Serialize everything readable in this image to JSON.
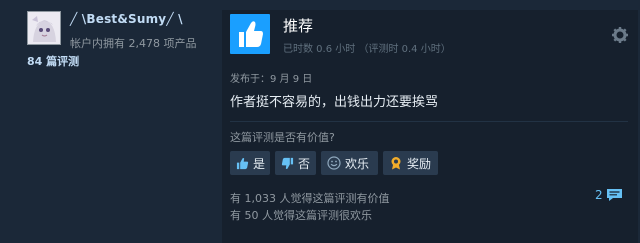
{
  "author": {
    "username": "╱ \\Best&Sumy╱ \\",
    "products_owned": "帐户内拥有 2,478 项产品",
    "reviews_count": "84 篇评测"
  },
  "review": {
    "verdict": "推荐",
    "hours": "已时数 0.6 小时  （评测时 0.4 小时）",
    "posted": "发布于：9 月 9 日",
    "content": "作者挺不容易的，出钱出力还要挨骂",
    "helpful_question": "这篇评测是否有价值?",
    "buttons": {
      "yes": "是",
      "no": "否",
      "funny": "欢乐",
      "award": "奖励"
    },
    "stats": {
      "helpful": "有 1,033 人觉得这篇评测有价值",
      "funny": "有 50 人觉得这篇评测很欢乐"
    },
    "comment_count": "2"
  },
  "icons": {
    "avatar": "anime-avatar",
    "verdict": "thumbs-up-icon",
    "options": "gear-icon",
    "yes": "thumbs-up-icon",
    "no": "thumbs-down-icon",
    "funny": "smiley-icon",
    "award": "award-icon",
    "comments": "comment-bubble-icon"
  },
  "colors": {
    "background": "#1b2838",
    "card": "#16202d",
    "accent": "#1a9fff",
    "link": "#66c0f4",
    "award": "#f1ac2a"
  }
}
